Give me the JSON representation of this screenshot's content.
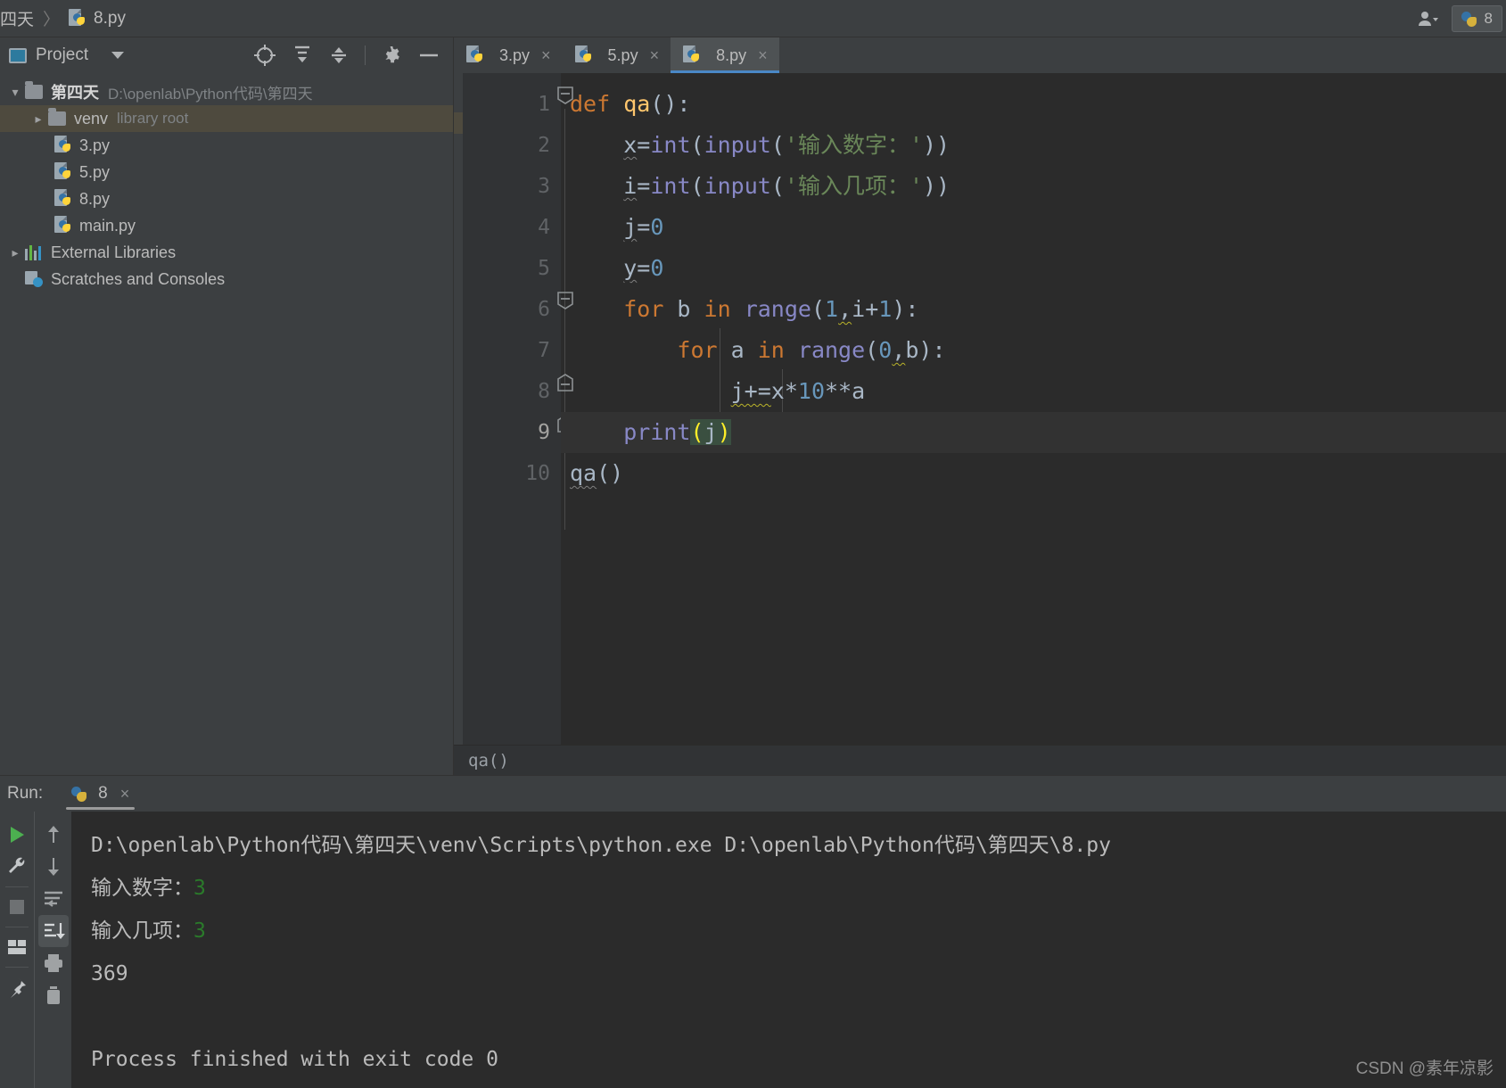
{
  "window": {
    "breadcrumb": {
      "project": "四天",
      "file": "8.py",
      "separator": "〉"
    },
    "run_config_label": "8",
    "user_icon": "user-avatar-icon"
  },
  "project_panel": {
    "title": "Project",
    "toolbar": [
      "locate-target-icon",
      "expand-all-icon",
      "collapse-all-icon",
      "settings-gear-icon",
      "hide-panel-icon"
    ],
    "tree": [
      {
        "label": "第四天",
        "detail": "D:\\openlab\\Python代码\\第四天",
        "icon": "folder-icon",
        "arrow": "chevron-down-icon",
        "depth": 0,
        "bold": true,
        "selected": false
      },
      {
        "label": "venv",
        "detail": "library root",
        "icon": "folder-icon",
        "arrow": "chevron-right-icon",
        "depth": 1,
        "bold": false,
        "selected": true
      },
      {
        "label": "3.py",
        "detail": "",
        "icon": "python-file-icon",
        "arrow": "",
        "depth": 2,
        "bold": false,
        "selected": false
      },
      {
        "label": "5.py",
        "detail": "",
        "icon": "python-file-icon",
        "arrow": "",
        "depth": 2,
        "bold": false,
        "selected": false
      },
      {
        "label": "8.py",
        "detail": "",
        "icon": "python-file-icon",
        "arrow": "",
        "depth": 2,
        "bold": false,
        "selected": false
      },
      {
        "label": "main.py",
        "detail": "",
        "icon": "python-file-icon",
        "arrow": "",
        "depth": 2,
        "bold": false,
        "selected": false
      },
      {
        "label": "External Libraries",
        "detail": "",
        "icon": "libraries-icon",
        "arrow": "chevron-right-icon",
        "depth": 0,
        "bold": false,
        "selected": false
      },
      {
        "label": "Scratches and Consoles",
        "detail": "",
        "icon": "scratches-icon",
        "arrow": "",
        "depth": 0,
        "bold": false,
        "selected": false
      }
    ]
  },
  "editor": {
    "tabs": [
      {
        "label": "3.py",
        "active": false
      },
      {
        "label": "5.py",
        "active": false
      },
      {
        "label": "8.py",
        "active": true
      }
    ],
    "close_glyph": "×",
    "line_numbers": [
      "1",
      "2",
      "3",
      "4",
      "5",
      "6",
      "7",
      "8",
      "9",
      "10"
    ],
    "current_line": 9,
    "code_lines": [
      "def qa():",
      "    x=int(input('输入数字：'))",
      "    i=int(input('输入几项：'))",
      "    j=0",
      "    y=0",
      "    for b in range(1,i+1):",
      "        for a in range(0,b):",
      "            j+=x*10**a",
      "    print(j)",
      "qa()"
    ],
    "breadcrumb": "qa()"
  },
  "run_panel": {
    "label": "Run:",
    "tab_label": "8",
    "close_glyph": "×",
    "toolbar_left": [
      "rerun-icon",
      "wrench-settings-icon",
      "stop-icon",
      "layout-icon",
      "pin-icon"
    ],
    "toolbar_right": [
      "up-arrow-icon",
      "down-arrow-icon",
      "soft-wrap-icon",
      "scroll-to-end-icon",
      "print-icon",
      "trash-icon"
    ],
    "console_lines": [
      {
        "text": "D:\\openlab\\Python代码\\第四天\\venv\\Scripts\\python.exe D:\\openlab\\Python代码\\第四天\\8.py",
        "input": ""
      },
      {
        "text": "输入数字：",
        "input": "3"
      },
      {
        "text": "输入几项：",
        "input": "3"
      },
      {
        "text": "369",
        "input": ""
      },
      {
        "text": "",
        "input": ""
      },
      {
        "text": "Process finished with exit code 0",
        "input": ""
      }
    ],
    "watermark": "CSDN @素年凉影"
  },
  "colors": {
    "background": "#3c3f41",
    "editor_bg": "#2b2b2b",
    "accent_tab": "#4a88c7",
    "keyword": "#cc7832",
    "function": "#ffc66d",
    "builtin": "#8888c6",
    "string": "#6a8759",
    "number": "#6897bb",
    "plain_text": "#a9b7c6",
    "bracket_match": "#ffef28",
    "console_input": "#2a7a2a",
    "selected_row": "#4e4a3e"
  }
}
